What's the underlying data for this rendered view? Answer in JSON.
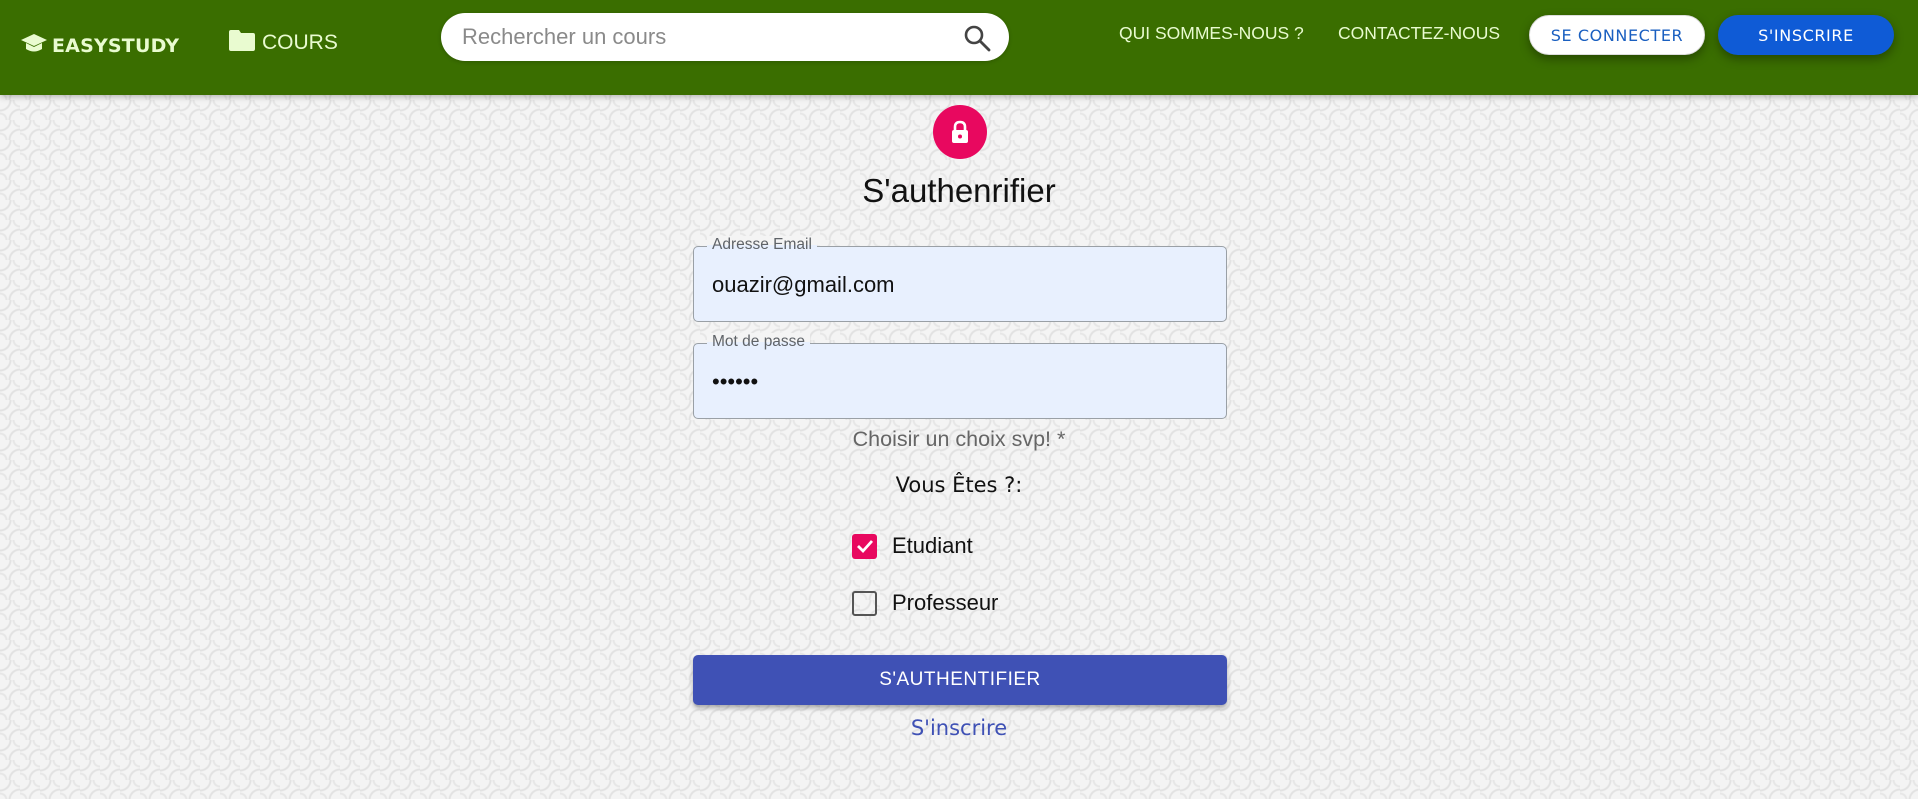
{
  "header": {
    "brand": "EASYSTUDY",
    "courses_label": "COURS",
    "search_placeholder": "Rechercher un cours",
    "about_label": "QUI SOMMES-NOUS ?",
    "contact_label": "CONTACTEZ-NOUS",
    "login_label": "SE CONNECTER",
    "signup_label": "S'INSCRIRE"
  },
  "form": {
    "title": "S'authenrifier",
    "email": {
      "label": "Adresse Email",
      "value": "ouazir@gmail.com"
    },
    "password": {
      "label": "Mot de passe",
      "value": "••••••"
    },
    "hint": "Choisir un choix svp! *",
    "question": "Vous Êtes ?:",
    "options": [
      {
        "label": "Etudiant",
        "checked": true
      },
      {
        "label": "Professeur",
        "checked": false
      }
    ],
    "submit_label": "S'AUTHENTIFIER",
    "signup_link": "S'inscrire"
  },
  "colors": {
    "header_bg": "#3a6e00",
    "accent_pink": "#e8085f",
    "primary_indigo": "#3f51b5",
    "signup_blue": "#0f5bd6"
  },
  "icons": [
    "graduation-cap-icon",
    "folder-icon",
    "search-icon",
    "lock-icon",
    "check-icon"
  ]
}
